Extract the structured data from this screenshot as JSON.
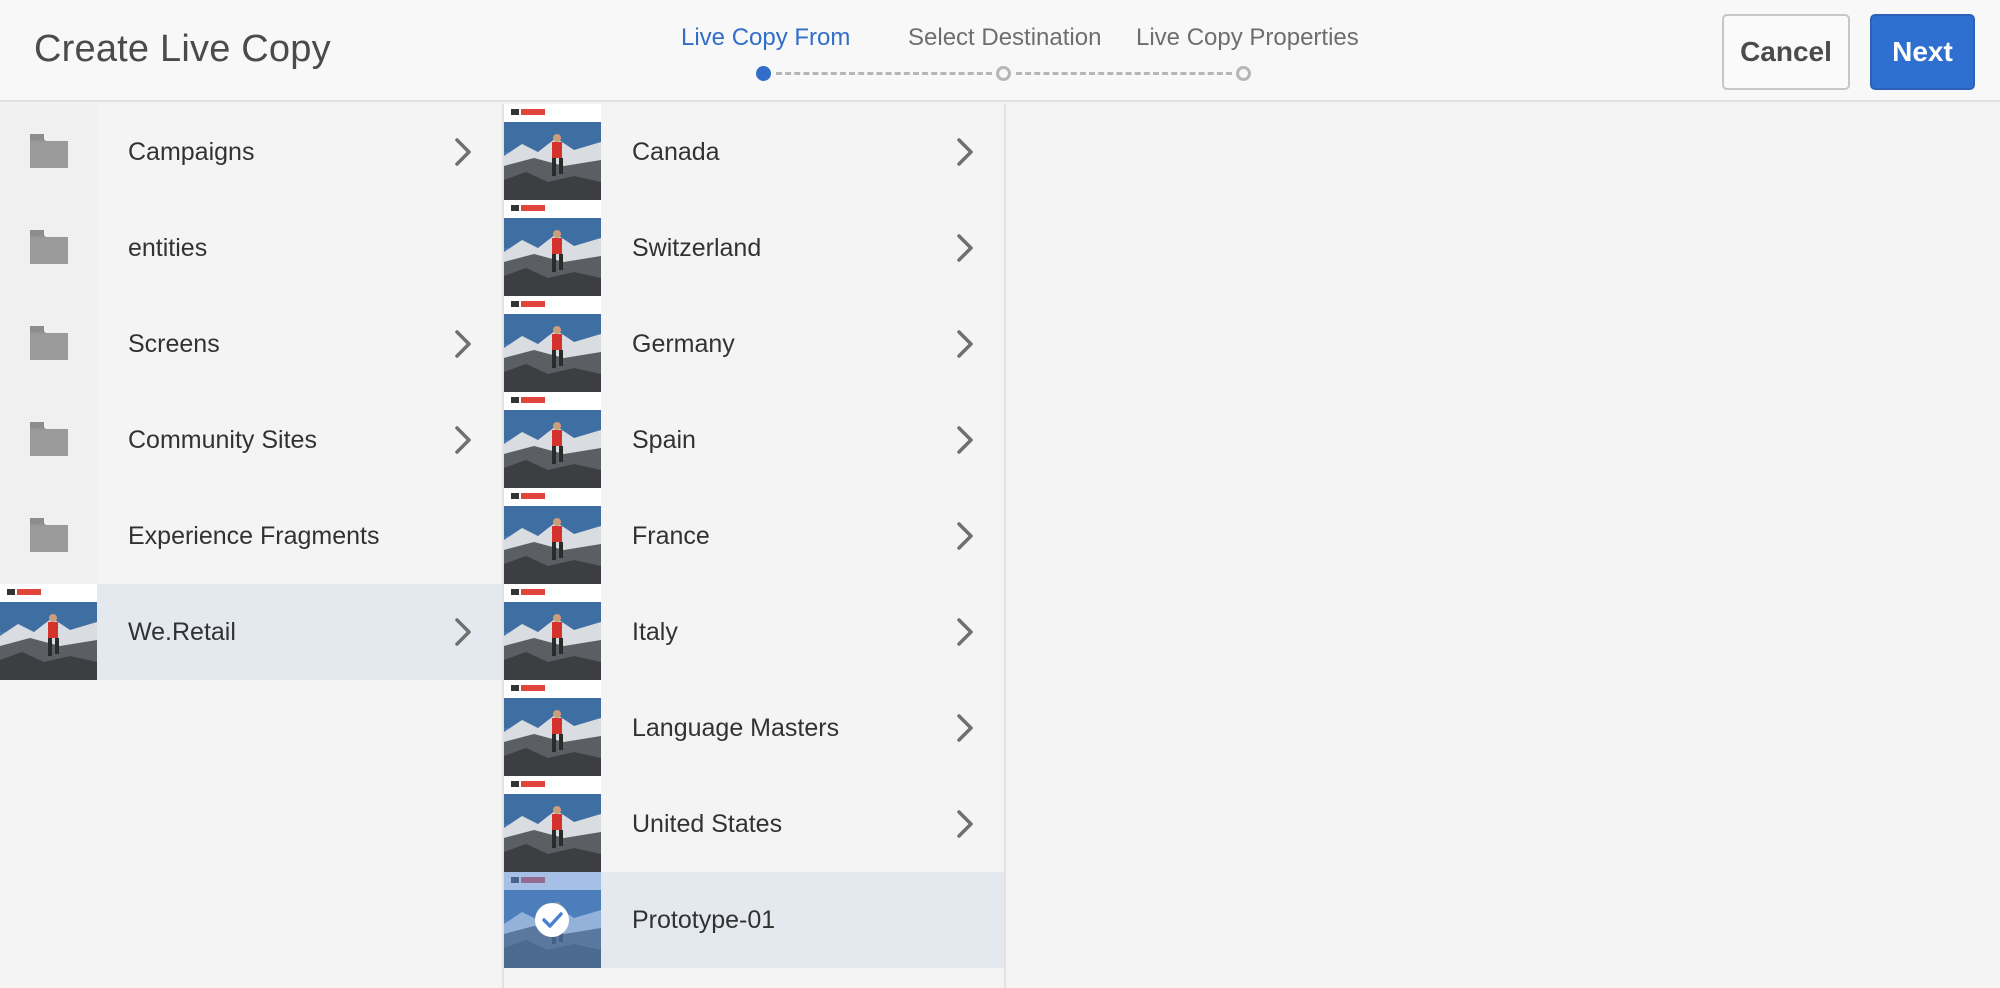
{
  "header": {
    "title": "Create Live Copy",
    "steps": [
      {
        "label": "Live Copy From",
        "state": "active"
      },
      {
        "label": "Select Destination",
        "state": "pending"
      },
      {
        "label": "Live Copy Properties",
        "state": "pending"
      }
    ],
    "cancel_label": "Cancel",
    "next_label": "Next"
  },
  "columns": [
    {
      "items": [
        {
          "label": "Campaigns",
          "icon": "folder-icon",
          "has_children": true,
          "selected": false
        },
        {
          "label": "entities",
          "icon": "folder-icon",
          "has_children": false,
          "selected": false
        },
        {
          "label": "Screens",
          "icon": "folder-icon",
          "has_children": true,
          "selected": false
        },
        {
          "label": "Community Sites",
          "icon": "folder-icon",
          "has_children": true,
          "selected": false
        },
        {
          "label": "Experience Fragments",
          "icon": "folder-icon",
          "has_children": false,
          "selected": false
        },
        {
          "label": "We.Retail",
          "icon": "site-thumbnail",
          "has_children": true,
          "selected": true
        }
      ]
    },
    {
      "items": [
        {
          "label": "Canada",
          "icon": "site-thumbnail",
          "has_children": true,
          "selected": false
        },
        {
          "label": "Switzerland",
          "icon": "site-thumbnail",
          "has_children": true,
          "selected": false
        },
        {
          "label": "Germany",
          "icon": "site-thumbnail",
          "has_children": true,
          "selected": false
        },
        {
          "label": "Spain",
          "icon": "site-thumbnail",
          "has_children": true,
          "selected": false
        },
        {
          "label": "France",
          "icon": "site-thumbnail",
          "has_children": true,
          "selected": false
        },
        {
          "label": "Italy",
          "icon": "site-thumbnail",
          "has_children": true,
          "selected": false
        },
        {
          "label": "Language Masters",
          "icon": "site-thumbnail",
          "has_children": true,
          "selected": false
        },
        {
          "label": "United States",
          "icon": "site-thumbnail",
          "has_children": true,
          "selected": false
        },
        {
          "label": "Prototype-01",
          "icon": "site-thumbnail",
          "has_children": false,
          "selected": true,
          "checked": true
        }
      ]
    }
  ],
  "colors": {
    "accent": "#326ec8",
    "selected_row": "#e4e9f0",
    "background": "#f4f4f4"
  }
}
